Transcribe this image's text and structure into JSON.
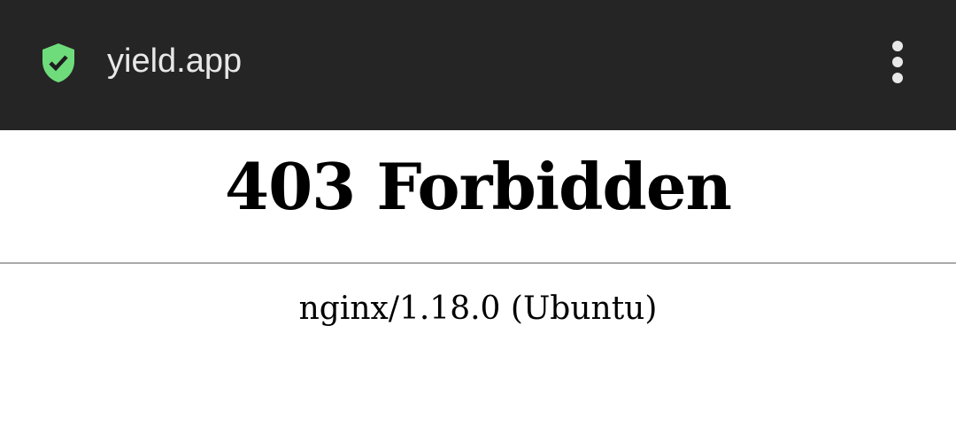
{
  "toolbar": {
    "title": "yield.app",
    "security_icon": "shield-check-icon",
    "security_color": "#6fdc7c",
    "menu_icon": "more-vert-icon"
  },
  "page": {
    "heading": "403 Forbidden",
    "footer": "nginx/1.18.0 (Ubuntu)"
  }
}
